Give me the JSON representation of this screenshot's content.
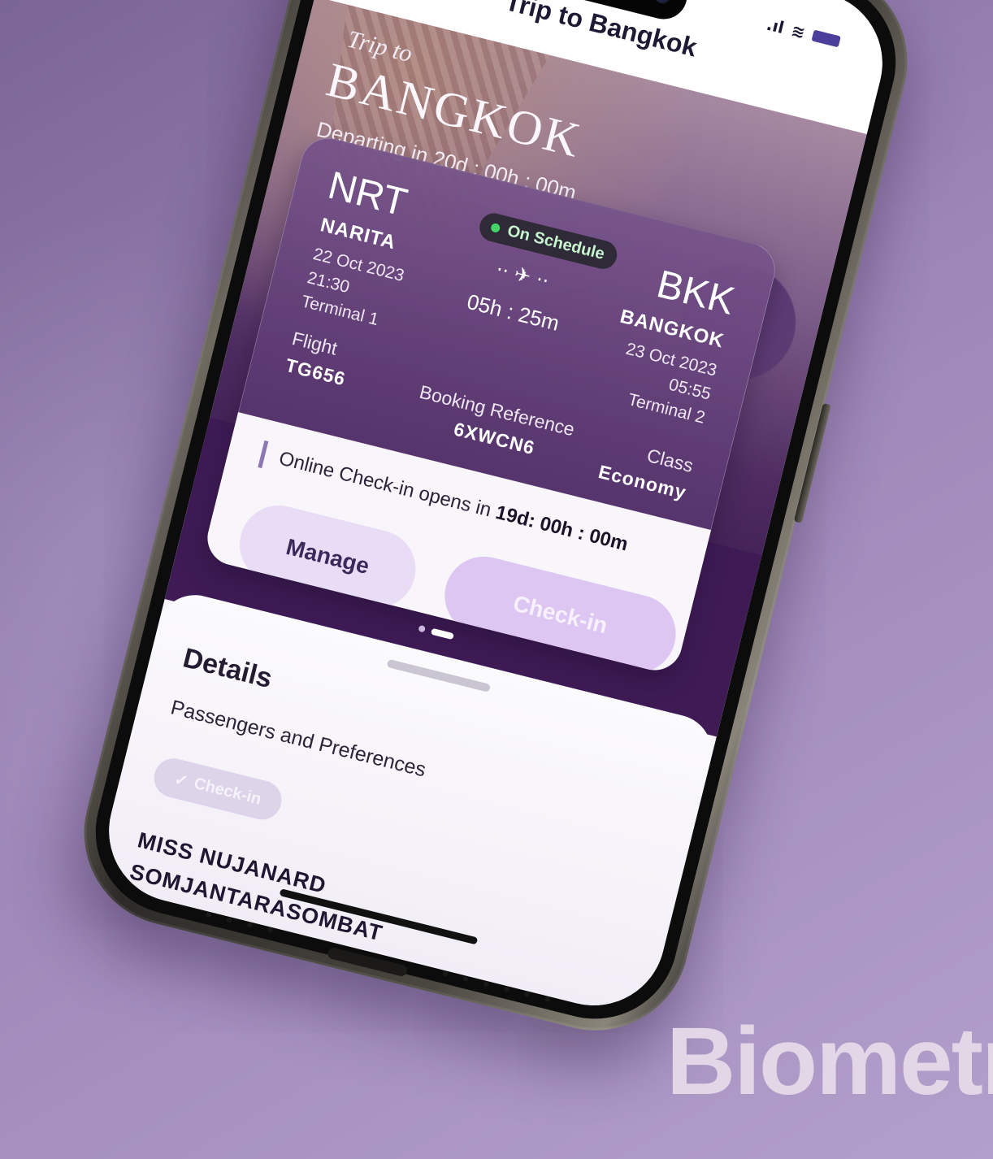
{
  "nav": {
    "back_icon": "chevron-left-icon",
    "title": "Trip to Bangkok"
  },
  "hero": {
    "subtitle": "Trip to",
    "title": "BANGKOK",
    "countdown": "Departing in 20d : 00h : 00m"
  },
  "flight": {
    "origin_code": "NRT",
    "origin_city": "NARITA",
    "origin_date": "22 Oct 2023",
    "origin_time": "21:30",
    "origin_terminal": "Terminal 1",
    "status": "On Schedule",
    "status_color": "#46d466",
    "plane_glyph": "·· ✈ ··",
    "duration": "05h : 25m",
    "dest_code": "BKK",
    "dest_city": "BANGKOK",
    "dest_date": "23 Oct 2023",
    "dest_time": "05:55",
    "dest_terminal": "Terminal 2",
    "flight_label": "Flight",
    "flight_number": "TG656",
    "booking_label": "Booking Reference",
    "booking_ref": "6XWCN6",
    "class_label": "Class",
    "class_value": "Economy"
  },
  "checkin": {
    "info_prefix": "Online Check-in opens in ",
    "info_time": "19d: 00h : 00m",
    "manage_label": "Manage",
    "checkin_label": "Check-in"
  },
  "details": {
    "title": "Details",
    "subtitle": "Passengers and Preferences",
    "tag_icon": "check-icon",
    "tag_label": "Check-in",
    "passenger_line1": "MISS NUJANARD",
    "passenger_line2": "SOMJANTARASOMBAT"
  },
  "overlay": {
    "corner_text": "Biometr"
  },
  "colors": {
    "accent": "#3e1b55",
    "background": "#9c86b8",
    "button_light": "#e9ddf6"
  }
}
